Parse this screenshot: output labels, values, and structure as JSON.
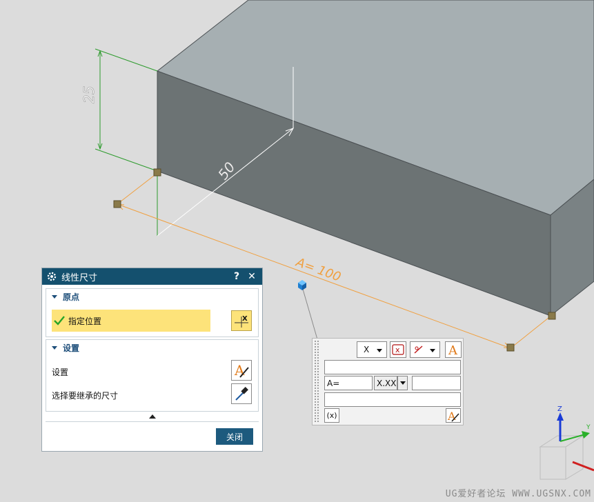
{
  "canvas": {
    "dim_height": "25",
    "dim_depth": "50",
    "dim_length": "A= 100",
    "axis_z": "Z"
  },
  "dialog": {
    "title": "线性尺寸",
    "help_label": "?",
    "close_icon_label": "✕",
    "origin_group": {
      "title": "原点",
      "specify_location": "指定位置"
    },
    "settings_group": {
      "title": "设置",
      "settings_label": "设置",
      "inherit_label": "选择要继承的尺寸"
    },
    "close_button": "关闭"
  },
  "onscreen_dim": {
    "text_option": "X",
    "expr_label": "A=",
    "format_value": "X.XX",
    "bottom_left_btn": "(x)"
  },
  "watermark": "UG爱好者论坛 WWW.UGSNX.COM",
  "colors": {
    "titlebar": "#14506e",
    "highlight": "#fde37a",
    "dim_green": "#2b9a2b",
    "dim_orange": "#f0a040"
  }
}
